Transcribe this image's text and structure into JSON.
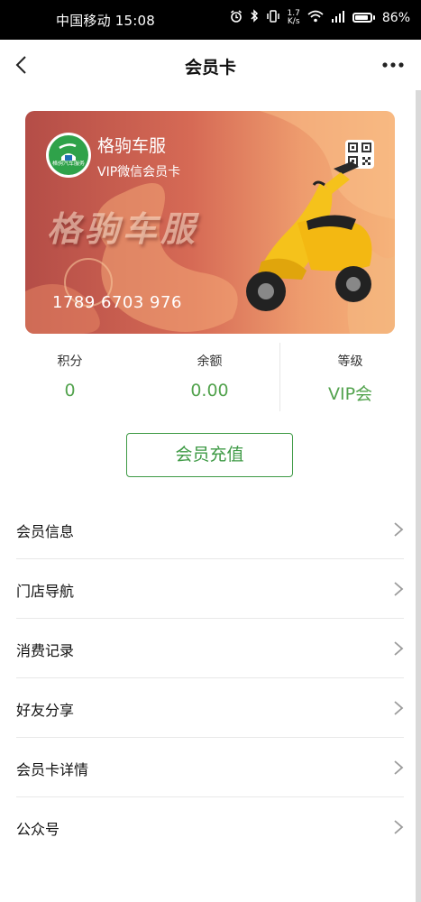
{
  "status_bar": {
    "carrier_time": "中国移动 15:08",
    "net_speed_value": "1.7",
    "net_speed_unit": "K/s",
    "battery": "86%",
    "battery_level": 0.86,
    "icons": [
      "alarm-icon",
      "bluetooth-icon",
      "vibrate-icon",
      "wifi-icon",
      "signal-icon",
      "battery-icon"
    ]
  },
  "nav": {
    "title": "会员卡"
  },
  "card": {
    "brand_name": "格驹车服",
    "subtitle": "VIP微信会员卡",
    "logo_text": "格驹汽车服务",
    "watermark": "格驹车服",
    "card_number": "1789 6703 976",
    "colors": {
      "gradient_start": "#b44d47",
      "gradient_end": "#f6b37a",
      "scooter": "#f5c21b"
    }
  },
  "stats": [
    {
      "label": "积分",
      "value": "0"
    },
    {
      "label": "余额",
      "value": "0.00"
    },
    {
      "label": "等级",
      "value": "VIP会"
    }
  ],
  "recharge_button": "会员充值",
  "menu": [
    {
      "label": "会员信息"
    },
    {
      "label": "门店导航"
    },
    {
      "label": "消费记录"
    },
    {
      "label": "好友分享"
    },
    {
      "label": "会员卡详情"
    },
    {
      "label": "公众号"
    }
  ],
  "accent_color": "#3e9a45"
}
